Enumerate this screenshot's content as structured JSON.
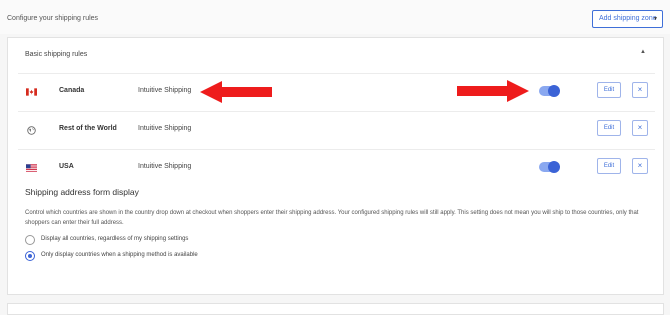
{
  "header": {
    "title": "Configure your shipping rules",
    "add_zone_label": "Add shipping zone"
  },
  "basic_rules": {
    "title": "Basic shipping rules",
    "rows": [
      {
        "country": "Canada",
        "flag": "canada-flag",
        "method": "Intuitive Shipping",
        "enabled": true,
        "edit_label": "Edit",
        "delete_label": "×"
      },
      {
        "country": "Rest of the World",
        "flag": "globe-icon",
        "method": "Intuitive Shipping",
        "enabled": false,
        "edit_label": "Edit",
        "delete_label": "×"
      },
      {
        "country": "USA",
        "flag": "usa-flag",
        "method": "Intuitive Shipping",
        "enabled": true,
        "edit_label": "Edit",
        "delete_label": "×"
      }
    ]
  },
  "address_form": {
    "title": "Shipping address form display",
    "description": "Control which countries are shown in the country drop down at checkout when shoppers enter their shipping address. Your configured shipping rules will still apply. This setting does not mean you will ship to those countries, only that shoppers can enter their full address.",
    "options": [
      {
        "label": "Display all countries, regardless of my shipping settings",
        "selected": false
      },
      {
        "label": "Only display countries when a shipping method is available",
        "selected": true
      }
    ]
  },
  "colors": {
    "accent": "#3b63d6",
    "annotation_arrow": "#ee1c1c"
  }
}
